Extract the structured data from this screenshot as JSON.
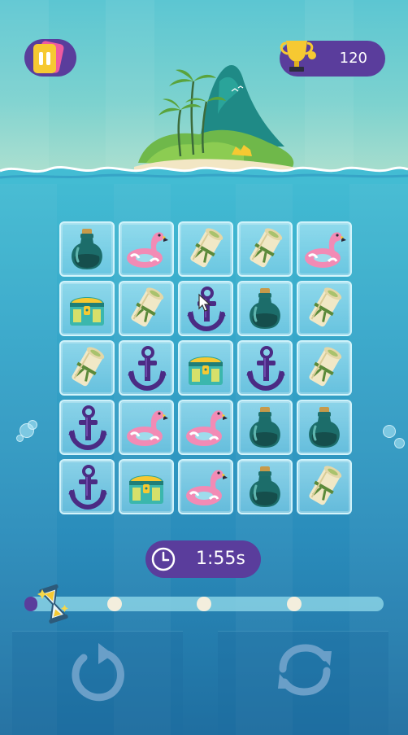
{
  "header": {
    "score": "120",
    "pause_icon": "pause-icon",
    "trophy_icon": "trophy-icon"
  },
  "board": {
    "rows": 5,
    "cols": 5,
    "tiles": [
      [
        "bottle",
        "flamingo",
        "scroll",
        "scroll",
        "flamingo"
      ],
      [
        "chest",
        "scroll",
        "anchor",
        "bottle",
        "scroll"
      ],
      [
        "scroll",
        "anchor",
        "chest",
        "anchor",
        "scroll"
      ],
      [
        "anchor",
        "flamingo",
        "flamingo",
        "bottle",
        "bottle"
      ],
      [
        "anchor",
        "chest",
        "flamingo",
        "bottle",
        "scroll"
      ]
    ]
  },
  "timer": {
    "text": "1:55s",
    "icon": "clock-icon"
  },
  "progress": {
    "fill_fraction": 0.03,
    "milestones": [
      0.25,
      0.5,
      0.75
    ]
  },
  "controls": {
    "undo_icon": "undo-icon",
    "shuffle_icon": "shuffle-icon"
  },
  "colors": {
    "accent_purple": "#5a3d9c",
    "pink": "#ef5aa0",
    "yellow": "#f6c932",
    "tile_border": "#e1faff"
  }
}
